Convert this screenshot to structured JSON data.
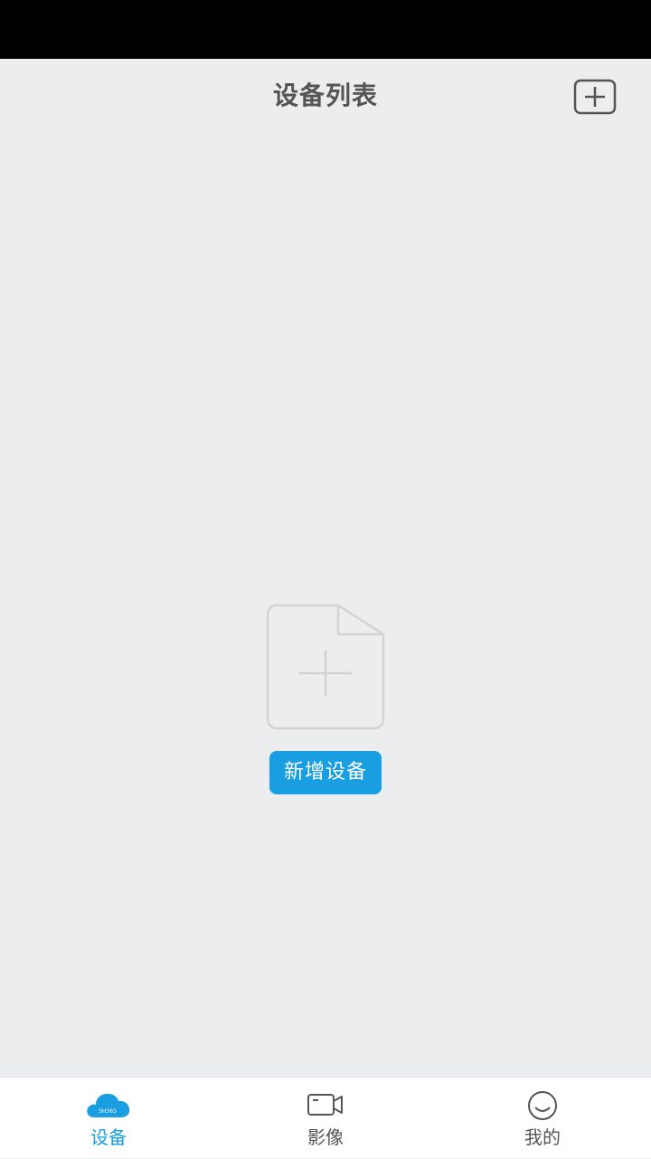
{
  "header": {
    "title": "设备列表",
    "add_icon": "plus-square-icon"
  },
  "empty_state": {
    "icon": "add-file-icon",
    "button_label": "新增设备"
  },
  "tab_bar": {
    "active_color": "#1a9ee2",
    "inactive_color": "#555555",
    "tabs": [
      {
        "label": "设备",
        "icon": "cloud-icon",
        "icon_text": "SH365",
        "active": true
      },
      {
        "label": "影像",
        "icon": "video-camera-icon",
        "active": false
      },
      {
        "label": "我的",
        "icon": "smiley-icon",
        "active": false
      }
    ]
  },
  "colors": {
    "background": "#ecedee",
    "status_bar": "#000000",
    "accent": "#1a9ee2"
  }
}
